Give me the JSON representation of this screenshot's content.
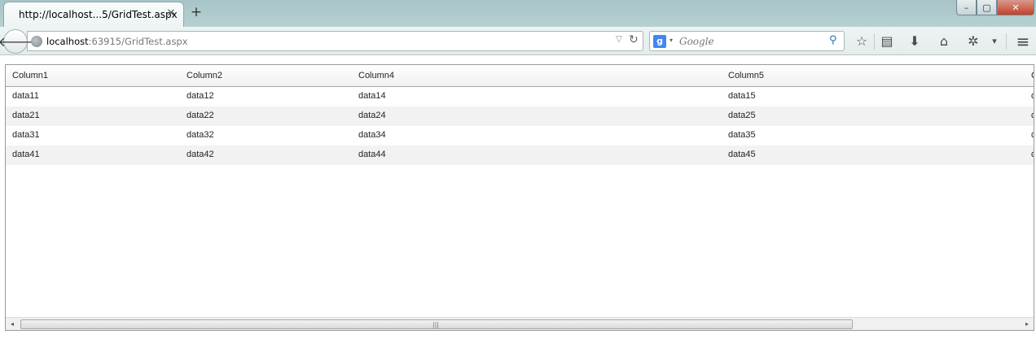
{
  "tab": {
    "title": "http://localhost...5/GridTest.aspx",
    "close_glyph": "✕"
  },
  "new_tab_glyph": "+",
  "window_controls": {
    "minimize": "–",
    "maximize": "▢",
    "close": "✕"
  },
  "nav": {
    "back_glyph": "🡐",
    "url_host": "localhost",
    "url_rest": ":63915/GridTest.aspx",
    "url_dropdown_glyph": "▽",
    "reload_glyph": "↻"
  },
  "search": {
    "engine_glyph": "g",
    "engine_arrow": "▾",
    "placeholder": "Google",
    "go_glyph": "⚲"
  },
  "toolbar": {
    "bookmark_glyph": "☆",
    "bookmarks_list_glyph": "▤",
    "download_glyph": "⬇",
    "home_glyph": "⌂",
    "addon_glyph": "✲",
    "dropdown_glyph": "▾",
    "menu_glyph": "≡"
  },
  "grid": {
    "columns": [
      "Column1",
      "Column2",
      "Column4",
      "Column5",
      "C"
    ],
    "rows": [
      [
        "data11",
        "data12",
        "data14",
        "data15",
        "d"
      ],
      [
        "data21",
        "data22",
        "data24",
        "data25",
        "d"
      ],
      [
        "data31",
        "data32",
        "data34",
        "data35",
        "d"
      ],
      [
        "data41",
        "data42",
        "data44",
        "data45",
        "d"
      ]
    ],
    "scroll_left_glyph": "◂",
    "scroll_right_glyph": "▸",
    "thumb_grip": "|||"
  },
  "colors": {
    "titlebar": "#a7c4c8",
    "toolbar": "#e9efef",
    "alt_row": "#f2f2f2",
    "close_button": "#c2412b"
  }
}
